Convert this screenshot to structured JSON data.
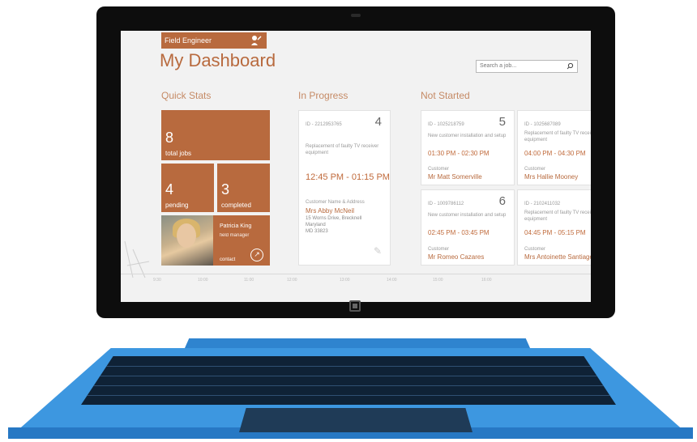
{
  "app": {
    "name": "Field Engineer"
  },
  "header": {
    "title": "My Dashboard",
    "search_placeholder": "Search a job..."
  },
  "sections": {
    "quick_stats": "Quick Stats",
    "in_progress": "In Progress",
    "not_started": "Not Started"
  },
  "stats": {
    "total": {
      "value": "8",
      "label": "total jobs"
    },
    "pending": {
      "value": "4",
      "label": "pending"
    },
    "completed": {
      "value": "3",
      "label": "completed"
    }
  },
  "person": {
    "name": "Patricia King",
    "role": "field manager",
    "action": "contact"
  },
  "in_progress_card": {
    "id": "ID - 2212953765",
    "number": "4",
    "description": "Replacement of faulty TV receiver equipment",
    "time": "12:45 PM  -  01:15 PM",
    "customer_label": "Customer Name & Address",
    "customer_name": "Mrs Abby McNeil",
    "address_line1": "15 Worns Drive,  Brecknell",
    "address_line2": "Maryland",
    "address_line3": "MD 33823"
  },
  "not_started_cards": [
    {
      "id": "ID - 1025218759",
      "number": "5",
      "description": "New customer installation and setup",
      "time": "01:30 PM  -  02:30 PM",
      "customer_label": "Customer",
      "customer": "Mr Matt Somerville"
    },
    {
      "id": "ID - 1025687089",
      "number": "",
      "description": "Replacement of faulty TV receiver equipment",
      "time": "04:00 PM  -  04:30 PM",
      "customer_label": "Customer",
      "customer": "Mrs Hallie Mooney"
    },
    {
      "id": "ID - 1009786112",
      "number": "6",
      "description": "New customer installation and setup",
      "time": "02:45 PM  -  03:45 PM",
      "customer_label": "Customer",
      "customer": "Mr Romeo Cazares"
    },
    {
      "id": "ID - 2102411032",
      "number": "",
      "description": "Replacement of faulty TV receiver equipment",
      "time": "04:45 PM  -  05:15 PM",
      "customer_label": "Customer",
      "customer": "Mrs Antoinette Santiago"
    }
  ],
  "timeline": [
    "9:30",
    "10:00",
    "11:00",
    "12:00",
    "13:00",
    "14:00",
    "15:00",
    "16:00"
  ],
  "colors": {
    "accent": "#b86a3e",
    "keyboard": "#3d97e0"
  },
  "icons": {
    "app": "engineer-wrench-icon",
    "search": "search-icon",
    "contact": "arrow-up-right-icon",
    "edit": "pencil-icon"
  }
}
